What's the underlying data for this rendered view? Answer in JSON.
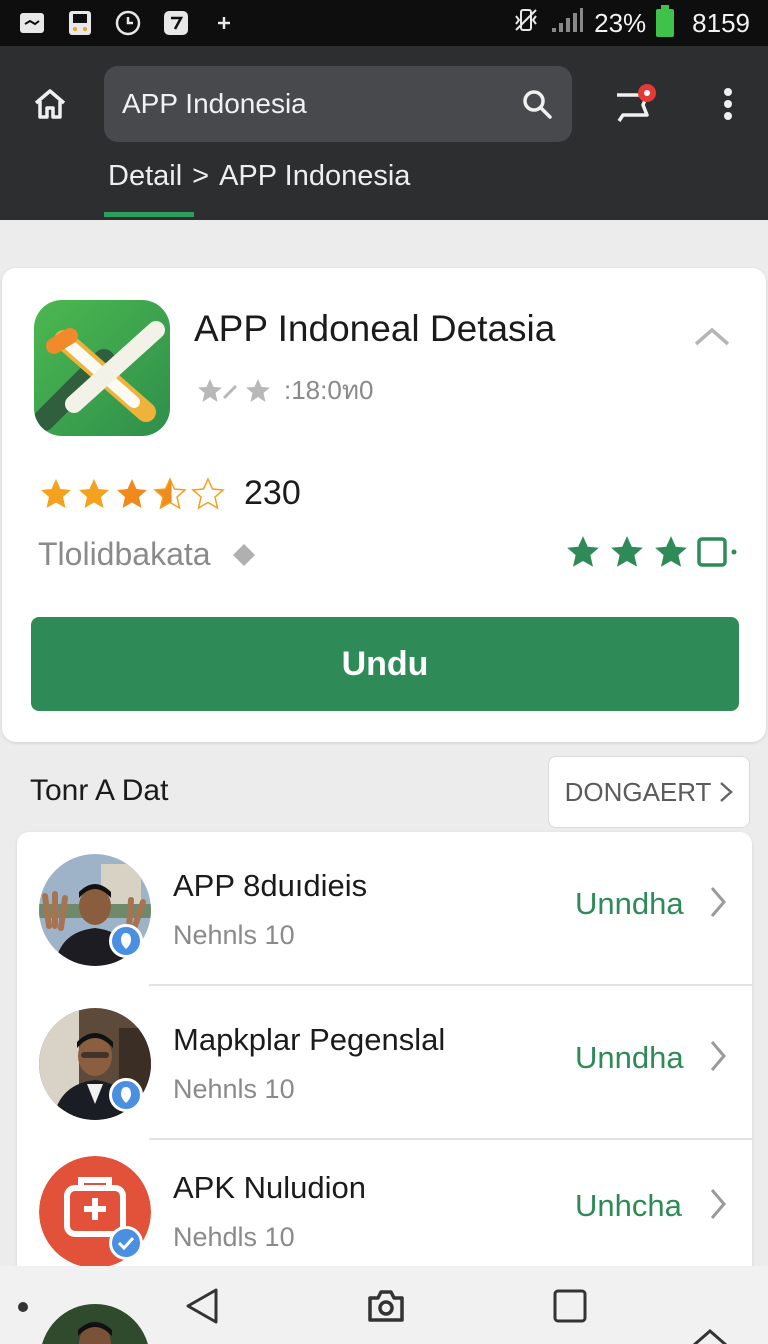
{
  "status_bar": {
    "battery": "23%",
    "time": "8159",
    "icons": [
      "message-icon",
      "sim-icon",
      "clock-icon",
      "nfc-icon",
      "plus-icon",
      "vibrate-icon",
      "signal-icon",
      "battery-icon"
    ]
  },
  "app_bar": {
    "search_text": "APP Indonesia",
    "breadcrumb_parent": "Detail",
    "breadcrumb_separator": ">",
    "breadcrumb_current": "APP Indonesia"
  },
  "app_detail": {
    "title": "APP Indoneal Detasia",
    "meta": ":18:0ท0",
    "rating_count": "230",
    "rating": 3.5,
    "category": "Tlolidbakata",
    "install_label": "Undu"
  },
  "section": {
    "title": "Tonr A Dat",
    "more_label": "DONGAERT"
  },
  "list_items": [
    {
      "title": "APP 8duıdieis",
      "subtitle": "Nehnls 10",
      "action": "Unndha"
    },
    {
      "title": "Mapkplar Pegenslal",
      "subtitle": "Nehnls 10",
      "action": "Unndha"
    },
    {
      "title": "APK Nuludion",
      "subtitle": "Nehdls 10",
      "action": "Unhcha"
    }
  ],
  "colors": {
    "accent_green": "#2e8b57",
    "toolbar": "#2d2e30",
    "star_gold": "#f4a11e",
    "notification_red": "#e53935"
  }
}
